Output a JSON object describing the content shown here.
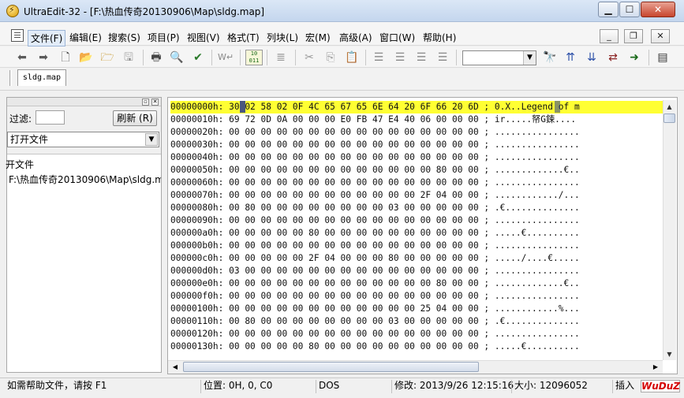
{
  "window": {
    "title": "UltraEdit-32 - [F:\\热血传奇20130906\\Map\\sldg.map]",
    "min_glyph": "▁",
    "max_glyph": "☐",
    "close_glyph": "✕"
  },
  "menu": [
    {
      "label": "文件(F)"
    },
    {
      "label": "编辑(E)"
    },
    {
      "label": "搜索(S)"
    },
    {
      "label": "项目(P)"
    },
    {
      "label": "视图(V)"
    },
    {
      "label": "格式(T)"
    },
    {
      "label": "列块(L)"
    },
    {
      "label": "宏(M)"
    },
    {
      "label": "高级(A)"
    },
    {
      "label": "窗口(W)"
    },
    {
      "label": "帮助(H)"
    }
  ],
  "mdi": {
    "min": "_",
    "restore": "❐",
    "close": "✕"
  },
  "toolbar": {
    "hex_toggle": "10\n011",
    "icons": [
      "back-icon",
      "forward-icon",
      "new-file-icon",
      "open-folder-icon",
      "open-file-icon",
      "save-icon",
      "print-icon",
      "print-preview-icon",
      "spellcheck-icon",
      "word-wrap-icon",
      "hex-mode-icon",
      "outdent-icon",
      "cut-icon",
      "copy-icon",
      "paste-icon",
      "align-left-icon",
      "align-center-icon",
      "align-right-icon",
      "justify-icon",
      "find-icon",
      "find-next-up-icon",
      "find-next-down-icon",
      "replace-icon",
      "goto-icon",
      "list-icon"
    ]
  },
  "tabs": [
    {
      "label": "sldg.map"
    }
  ],
  "left_pane": {
    "filter_label": "过滤:",
    "filter_value": "",
    "refresh_label": "刷新 (R)",
    "open_files_option": "打开文件",
    "tree_root": "开文件",
    "tree_item": "F:\\热血传奇20130906\\Map\\sldg.map"
  },
  "hex_rows": [
    {
      "addr": "00000000h:",
      "bytes": "30 02 58 02 0F 4C 65 67 65 6E 64 20 6F 66 20 6D",
      "ascii": "0.X..Legend of m",
      "highlight": true
    },
    {
      "addr": "00000010h:",
      "bytes": "69 72 0D 0A 00 00 00 E0 FB 47 E4 40 06 00 00 00",
      "ascii": "ir.....帑G鋉....",
      "highlight": false
    },
    {
      "addr": "00000020h:",
      "bytes": "00 00 00 00 00 00 00 00 00 00 00 00 00 00 00 00",
      "ascii": "................",
      "highlight": false
    },
    {
      "addr": "00000030h:",
      "bytes": "00 00 00 00 00 00 00 00 00 00 00 00 00 00 00 00",
      "ascii": "................",
      "highlight": false
    },
    {
      "addr": "00000040h:",
      "bytes": "00 00 00 00 00 00 00 00 00 00 00 00 00 00 00 00",
      "ascii": "................",
      "highlight": false
    },
    {
      "addr": "00000050h:",
      "bytes": "00 00 00 00 00 00 00 00 00 00 00 00 00 80 00 00",
      "ascii": ".............€..",
      "highlight": false
    },
    {
      "addr": "00000060h:",
      "bytes": "00 00 00 00 00 00 00 00 00 00 00 00 00 00 00 00",
      "ascii": "................",
      "highlight": false
    },
    {
      "addr": "00000070h:",
      "bytes": "00 00 00 00 00 00 00 00 00 00 00 00 2F 04 00 00",
      "ascii": "............/...",
      "highlight": false
    },
    {
      "addr": "00000080h:",
      "bytes": "00 80 00 00 00 00 00 00 00 00 03 00 00 00 00 00",
      "ascii": ".€..............",
      "highlight": false
    },
    {
      "addr": "00000090h:",
      "bytes": "00 00 00 00 00 00 00 00 00 00 00 00 00 00 00 00",
      "ascii": "................",
      "highlight": false
    },
    {
      "addr": "000000a0h:",
      "bytes": "00 00 00 00 00 80 00 00 00 00 00 00 00 00 00 00",
      "ascii": ".....€..........",
      "highlight": false
    },
    {
      "addr": "000000b0h:",
      "bytes": "00 00 00 00 00 00 00 00 00 00 00 00 00 00 00 00",
      "ascii": "................",
      "highlight": false
    },
    {
      "addr": "000000c0h:",
      "bytes": "00 00 00 00 00 2F 04 00 00 00 80 00 00 00 00 00",
      "ascii": "...../....€.....",
      "highlight": false
    },
    {
      "addr": "000000d0h:",
      "bytes": "03 00 00 00 00 00 00 00 00 00 00 00 00 00 00 00",
      "ascii": "................",
      "highlight": false
    },
    {
      "addr": "000000e0h:",
      "bytes": "00 00 00 00 00 00 00 00 00 00 00 00 00 80 00 00",
      "ascii": ".............€..",
      "highlight": false
    },
    {
      "addr": "000000f0h:",
      "bytes": "00 00 00 00 00 00 00 00 00 00 00 00 00 00 00 00",
      "ascii": "................",
      "highlight": false
    },
    {
      "addr": "00000100h:",
      "bytes": "00 00 00 00 00 00 00 00 00 00 00 00 25 04 00 00",
      "ascii": "............%...",
      "highlight": false
    },
    {
      "addr": "00000110h:",
      "bytes": "00 80 00 00 00 00 00 00 00 00 03 00 00 00 00 00",
      "ascii": ".€..............",
      "highlight": false
    },
    {
      "addr": "00000120h:",
      "bytes": "00 00 00 00 00 00 00 00 00 00 00 00 00 00 00 00",
      "ascii": "................",
      "highlight": false
    },
    {
      "addr": "00000130h:",
      "bytes": "00 00 00 00 00 80 00 00 00 00 00 00 00 00 00 00",
      "ascii": ".....€..........",
      "highlight": false
    }
  ],
  "status": {
    "help": "如需帮助文件，请按 F1",
    "position": "位置: 0H, 0, C0",
    "line_ending": "DOS",
    "modified": "修改: 2013/9/26 12:15:16",
    "size": "大小: 12096052",
    "mode": "插入",
    "brand": "WuDuZ"
  },
  "colors": {
    "highlight_row": "#ffff33",
    "cursor": "#2a3a8c",
    "brand": "#d40000"
  }
}
